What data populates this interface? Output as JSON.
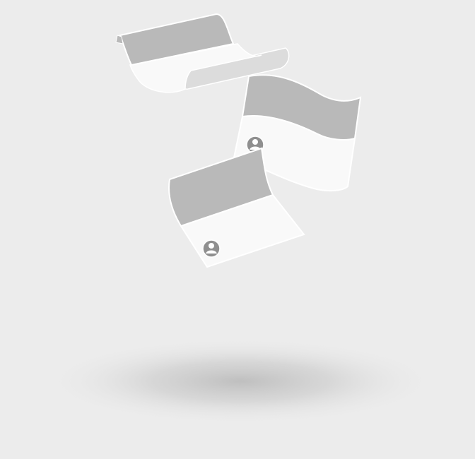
{
  "scene": {
    "background": "#ececec",
    "card_header_color": "#b9b9b9",
    "card_body_color": "#f9f9f9",
    "card_back_color": "#dcdcdc",
    "avatar_color": "#8f8f8f",
    "shadow_color": "#9a9a9a",
    "items": [
      {
        "kind": "card",
        "variant": "curled",
        "has_avatar": false,
        "icon": null
      },
      {
        "kind": "card",
        "variant": "waving",
        "has_avatar": true,
        "icon": "user-avatar-icon"
      },
      {
        "kind": "card",
        "variant": "bent",
        "has_avatar": true,
        "icon": "user-avatar-icon"
      }
    ]
  }
}
